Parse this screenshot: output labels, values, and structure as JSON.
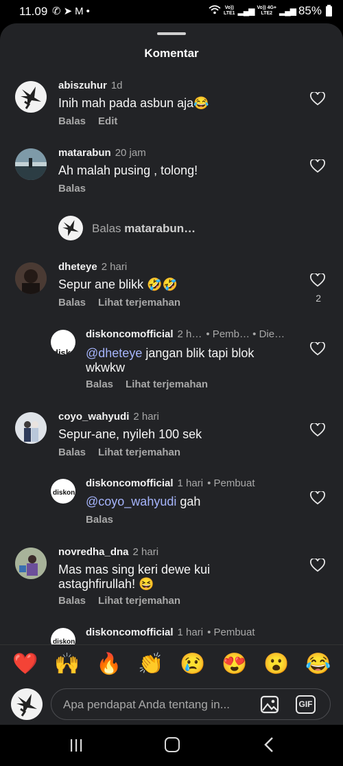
{
  "status": {
    "time": "11.09",
    "net1_top": "Vo))",
    "net1_bottom": "LTE1",
    "net2_top": "Vo)) 4G+",
    "net2_bottom": "LTE2",
    "battery": "85%"
  },
  "sheet": {
    "title": "Komentar"
  },
  "reply_prompt": {
    "prefix": "Balas ",
    "user": "matarabun…"
  },
  "comments": [
    {
      "user": "abiszuhur",
      "time": "1d",
      "text": "Inih mah pada asbun aja😂",
      "actions": [
        "Balas",
        "Edit"
      ]
    },
    {
      "user": "matarabun",
      "time": "20 jam",
      "text": "Ah malah pusing , tolong!",
      "actions": [
        "Balas"
      ]
    },
    {
      "user": "dheteye",
      "time": "2 hari",
      "text": "Sepur ane blikk 🤣🤣",
      "actions": [
        "Balas",
        "Lihat terjemahan"
      ],
      "likes": "2"
    },
    {
      "user": "diskoncomofficial",
      "time": "2 h…",
      "extra": "• Pemb…  • Die…",
      "mention": "@dheteye",
      "text": " jangan blik tapi blok wkwkw",
      "actions": [
        "Balas",
        "Lihat terjemahan"
      ]
    },
    {
      "user": "coyo_wahyudi",
      "time": "2 hari",
      "text": "Sepur-ane, nyileh 100 sek",
      "actions": [
        "Balas",
        "Lihat terjemahan"
      ]
    },
    {
      "user": "diskoncomofficial",
      "time": "1 hari",
      "extra": "• Pembuat",
      "mention": "@coyo_wahyudi",
      "text": " gah",
      "actions": [
        "Balas"
      ]
    },
    {
      "user": "novredha_dna",
      "time": "2 hari",
      "text": "Mas mas sing keri dewe kui astaghfirullah! 😆",
      "actions": [
        "Balas",
        "Lihat terjemahan"
      ]
    },
    {
      "user": "diskoncomofficial",
      "time": "1 hari",
      "extra": "• Pembuat"
    }
  ],
  "logo_text": "diskon",
  "emoji_bar": [
    "❤️",
    "🙌",
    "🔥",
    "👏",
    "😢",
    "😍",
    "😮",
    "😂"
  ],
  "input": {
    "placeholder": "Apa pendapat Anda tentang in...",
    "gif_label": "GIF"
  },
  "colors": {
    "sheet_bg": "#222326",
    "mention": "#a5b4fc",
    "muted": "#a8a8a8"
  }
}
